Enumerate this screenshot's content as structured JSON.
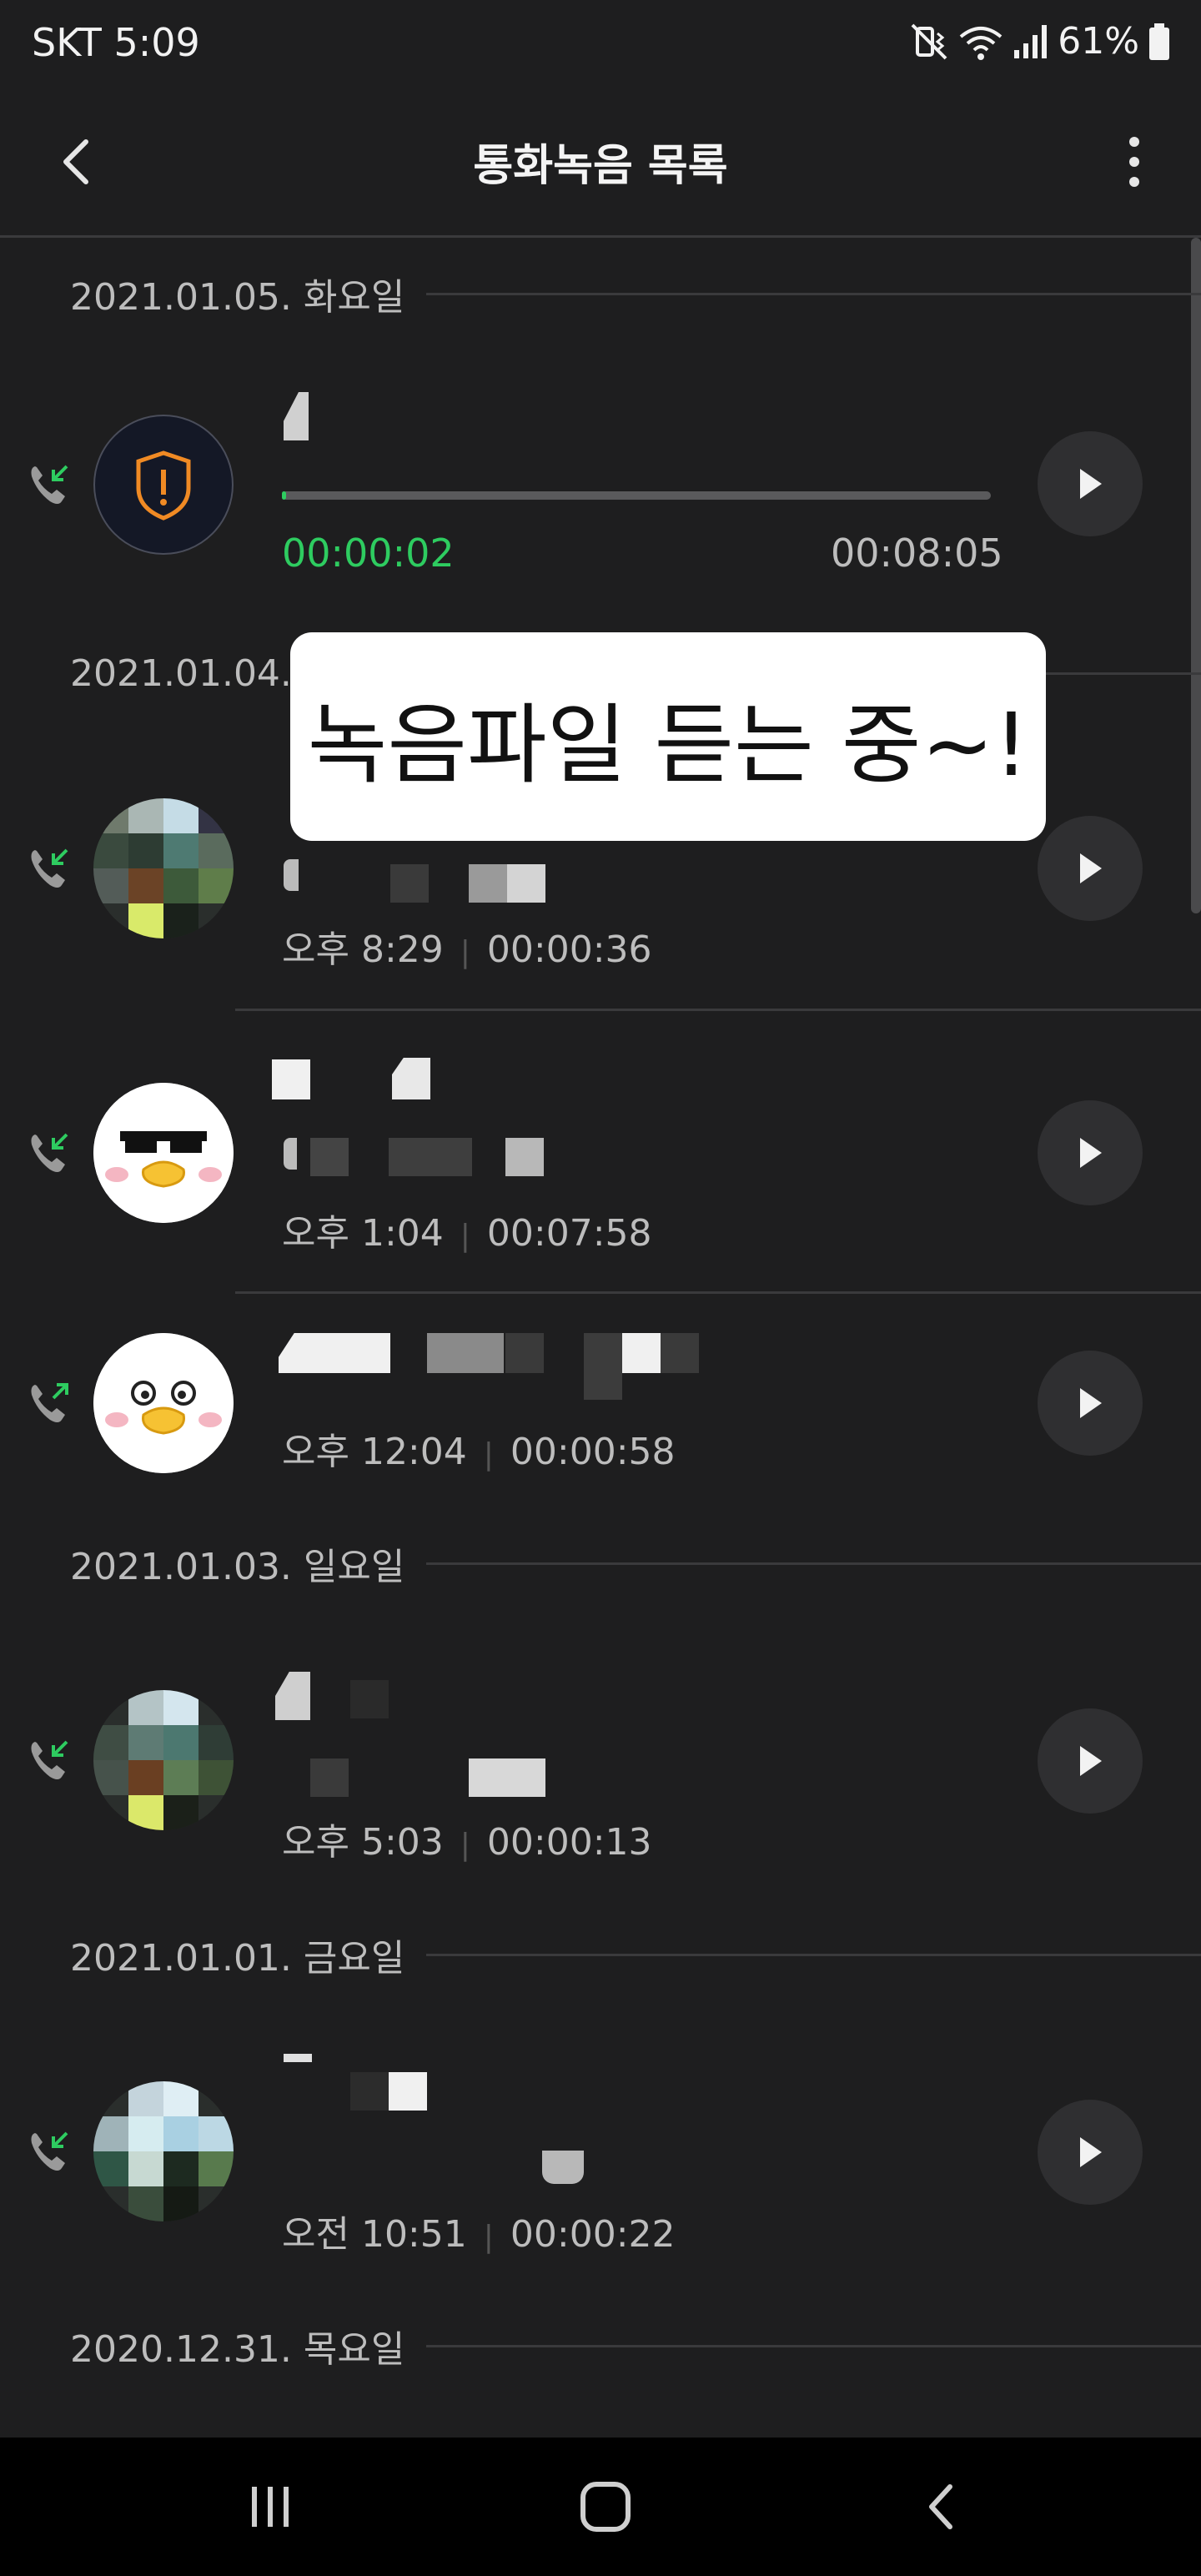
{
  "status_bar": {
    "carrier_time": "SKT 5:09",
    "battery": "61%",
    "icons": [
      "mute-vibrate-icon",
      "wifi-icon",
      "signal-icon",
      "battery-icon"
    ]
  },
  "app_bar": {
    "title": "통화녹음 목록",
    "back_icon": "chevron-left-icon",
    "more_icon": "more-vertical-icon"
  },
  "accent": {
    "green": "#2ecc60",
    "background": "#1e1e1f"
  },
  "sections": [
    {
      "date": "2021.01.05. 화요일",
      "items": [
        {
          "direction": "incoming",
          "avatar": "shield-warning-icon",
          "playing": true,
          "progress_fraction": 0.004,
          "elapsed": "00:00:02",
          "total": "00:08:05"
        }
      ]
    },
    {
      "date": "2021.01.04.",
      "items": [
        {
          "direction": "incoming",
          "avatar": "pixelated-photo",
          "time": "오후 8:29",
          "duration": "00:00:36"
        },
        {
          "direction": "incoming",
          "avatar": "duck-sunglasses-avatar",
          "time": "오후 1:04",
          "duration": "00:07:58"
        },
        {
          "direction": "outgoing",
          "avatar": "duck-avatar",
          "time": "오후 12:04",
          "duration": "00:00:58"
        }
      ]
    },
    {
      "date": "2021.01.03. 일요일",
      "items": [
        {
          "direction": "incoming",
          "avatar": "pixelated-photo",
          "time": "오후 5:03",
          "duration": "00:00:13"
        }
      ]
    },
    {
      "date": "2021.01.01. 금요일",
      "items": [
        {
          "direction": "incoming",
          "avatar": "pixelated-photo",
          "time": "오전 10:51",
          "duration": "00:00:22"
        }
      ]
    },
    {
      "date": "2020.12.31. 목요일",
      "items": []
    }
  ],
  "overlay": {
    "text": "녹음파일 듣는 중~!"
  },
  "nav_bar": {
    "icons": [
      "recent-apps-icon",
      "home-icon",
      "back-icon"
    ]
  }
}
